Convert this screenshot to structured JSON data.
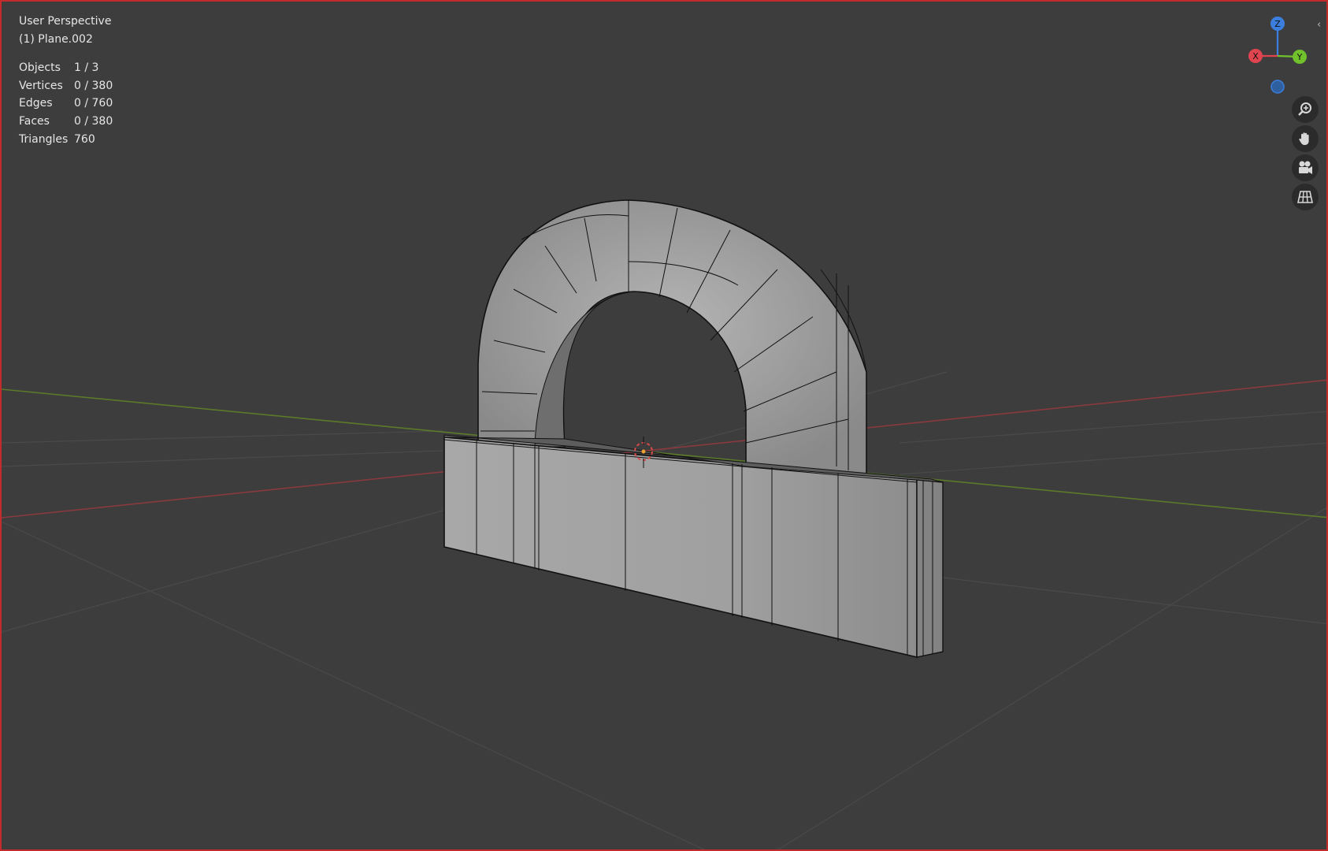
{
  "viewport": {
    "view_name": "User Perspective",
    "active_object": "(1) Plane.002"
  },
  "stats": [
    {
      "label": "Objects",
      "value": "1 / 3"
    },
    {
      "label": "Vertices",
      "value": "0 / 380"
    },
    {
      "label": "Edges",
      "value": "0 / 760"
    },
    {
      "label": "Faces",
      "value": "0 / 380"
    },
    {
      "label": "Triangles",
      "value": "760"
    }
  ],
  "gizmo": {
    "x_label": "X",
    "y_label": "Y",
    "z_label": "Z",
    "x_color": "#e0454f",
    "y_color": "#71c12c",
    "z_color": "#3b7ede"
  },
  "nav_buttons": [
    {
      "name": "zoom",
      "icon": "zoom-icon"
    },
    {
      "name": "pan",
      "icon": "hand-icon"
    },
    {
      "name": "camera",
      "icon": "camera-icon"
    },
    {
      "name": "perspective",
      "icon": "grid-icon"
    }
  ],
  "colors": {
    "background": "#3d3d3d",
    "frame_border": "#c42b2b",
    "mesh_fill": "#9c9c9c",
    "wire": "#111111"
  }
}
